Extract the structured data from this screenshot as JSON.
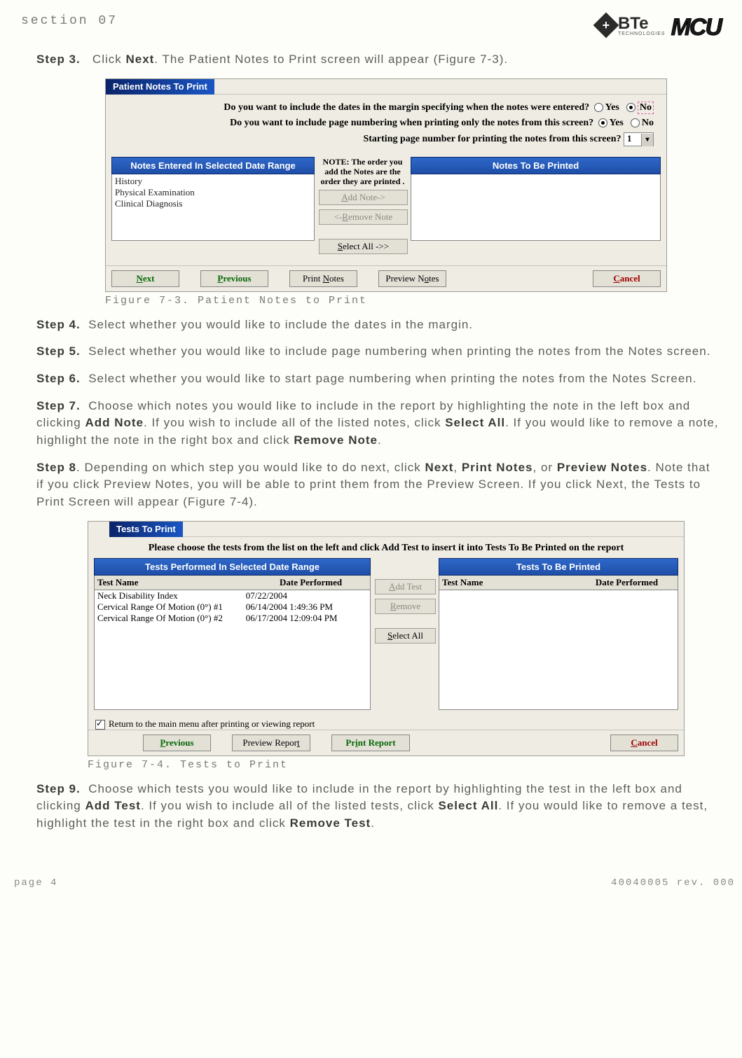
{
  "header": {
    "section_label": "section 07",
    "bte_text": "BTe",
    "bte_sub": "TECHNOLOGIES",
    "mcu_text": "MCU"
  },
  "steps": {
    "s3_label": "Step 3.",
    "s3_text_a": "Click ",
    "s3_bold": "Next",
    "s3_text_b": ". The Patient Notes to Print screen will appear (Figure 7-3).",
    "s4_label": "Step 4.",
    "s4_text": "Select whether you would like to include the dates in the margin.",
    "s5_label": "Step 5.",
    "s5_text": "Select whether you would like to include page numbering when printing the notes from the Notes screen.",
    "s6_label": "Step 6.",
    "s6_text": "Select whether you would like to start page numbering when printing the notes from the Notes Screen.",
    "s7_label": "Step 7.",
    "s7_a": "Choose which notes you would like to include in the report by highlighting the note in the left box and clicking ",
    "s7_b1": "Add Note",
    "s7_c": ". If you wish to include all of the listed notes, click ",
    "s7_b2": "Select All",
    "s7_d": ". If you would like to remove a note, highlight the note in the right box and click ",
    "s7_b3": "Remove Note",
    "s7_e": ".",
    "s8_label": "Step 8",
    "s8_a": ".   Depending on which step you would like to do next, click ",
    "s8_b1": "Next",
    "s8_c": ", ",
    "s8_b2": "Print Notes",
    "s8_d": ", or ",
    "s8_b3": "Preview Notes",
    "s8_e": ". Note that if you click Preview Notes, you will be able to print them from the Preview Screen. If you click Next, the Tests to Print Screen will appear (Figure 7-4).",
    "s9_label": "Step 9.",
    "s9_a": "Choose which tests you would like to include in the report by highlighting the test in the left box and clicking ",
    "s9_b1": "Add Test",
    "s9_c": ". If you wish to include all of the listed tests, click ",
    "s9_b2": "Select All",
    "s9_d": ". If you would like to remove a test, highlight the test in the right box and click ",
    "s9_b3": "Remove Test",
    "s9_e": "."
  },
  "fig1": {
    "caption": "Figure 7-3. Patient Notes to Print",
    "title": "Patient Notes To Print",
    "q1": "Do you want to include the dates in the margin specifying when the notes were entered?",
    "q2": "Do you want to include page numbering when printing only the notes from this screen?",
    "q3": "Starting page number for printing the notes from this screen?",
    "yes": "Yes",
    "no": "No",
    "combo_val": "1",
    "left_header": "Notes Entered In Selected Date Range",
    "right_header": "Notes To Be Printed",
    "mid_note": "NOTE: The order you add the Notes are the order they are printed .",
    "add_btn": "Add Note->",
    "remove_btn": "<-Remove Note",
    "selectall_btn": "Select All ->>",
    "items": [
      "History",
      "Physical Examination",
      "Clinical Diagnosis"
    ],
    "bottom": {
      "next": "Next",
      "prev": "Previous",
      "print": "Print Notes",
      "preview": "Preview Notes",
      "cancel": "Cancel"
    }
  },
  "fig2": {
    "caption": "Figure 7-4. Tests to Print",
    "title": "Tests To Print",
    "instr": "Please choose the tests from the list on the left and click Add Test to insert it into Tests To Be Printed on the report",
    "left_header": "Tests Performed In Selected Date Range",
    "right_header": "Tests To Be Printed",
    "col_test": "Test Name",
    "col_date": "Date Performed",
    "rows": [
      {
        "name": "Neck Disability Index",
        "date": "07/22/2004"
      },
      {
        "name": "Cervical Range Of Motion (0°) #1",
        "date": "06/14/2004 1:49:36 PM"
      },
      {
        "name": "Cervical Range Of Motion (0°) #2",
        "date": "06/17/2004 12:09:04 PM"
      }
    ],
    "mid": {
      "add": "Add Test",
      "remove": "Remove",
      "selectall": "Select All"
    },
    "chk_label": "Return to the main menu after printing or viewing report",
    "bottom": {
      "prev": "Previous",
      "preview": "Preview Report",
      "print": "Print Report",
      "cancel": "Cancel"
    }
  },
  "footer": {
    "page": "page 4",
    "doc": "40040005 rev. 000"
  }
}
